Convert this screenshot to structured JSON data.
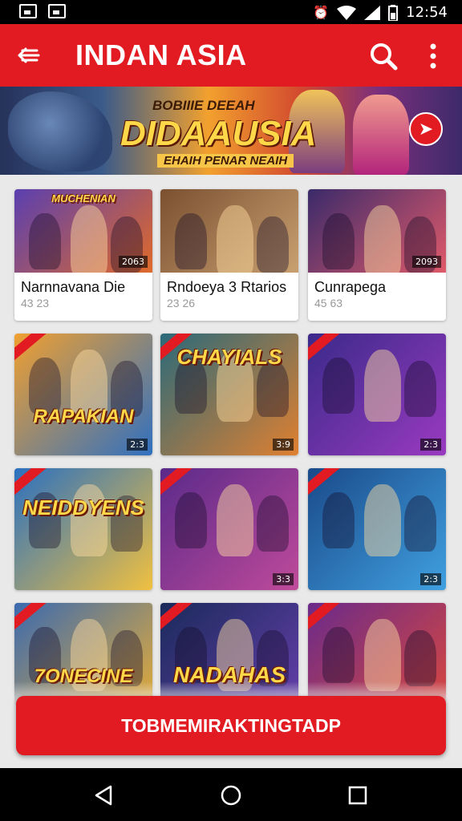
{
  "status_bar": {
    "time": "12:54"
  },
  "app_bar": {
    "title": "INDAN ASIA"
  },
  "banner": {
    "top_text": "BOBIIIE DEEAH",
    "title": "DIDAAUSIA",
    "subtitle": "EHAIH PENAR NEAIH"
  },
  "cards": [
    {
      "title": "Narnnavana Die",
      "meta": "43 23",
      "art_text": "MUCHENIAN",
      "badge": "2063",
      "colors": [
        "#5a3fb0",
        "#e06a2a"
      ],
      "style": "labeled"
    },
    {
      "title": "Rndoeya 3 Rtarios",
      "meta": "23 26",
      "art_text": "",
      "badge": "",
      "colors": [
        "#7a5030",
        "#c8a070"
      ],
      "style": "labeled"
    },
    {
      "title": "Cunrapega",
      "meta": "45 63",
      "art_text": "",
      "badge": "2093",
      "colors": [
        "#3a2a6a",
        "#e05a6a"
      ],
      "style": "labeled"
    },
    {
      "title": "",
      "meta": "",
      "art_text": "RAPAKIAN",
      "badge": "2:3",
      "colors": [
        "#f0a030",
        "#3070c0"
      ],
      "style": "art"
    },
    {
      "title": "",
      "meta": "",
      "art_text": "CHAYIALS",
      "badge": "3:9",
      "colors": [
        "#2a6a7a",
        "#e08030"
      ],
      "style": "art"
    },
    {
      "title": "",
      "meta": "",
      "art_text": "",
      "badge": "2:3",
      "colors": [
        "#3a2a8a",
        "#9a3ac0"
      ],
      "style": "art"
    },
    {
      "title": "",
      "meta": "",
      "art_text": "NEIDDYENS",
      "badge": "",
      "colors": [
        "#2a70c0",
        "#f0c040"
      ],
      "style": "art"
    },
    {
      "title": "",
      "meta": "",
      "art_text": "",
      "badge": "3:3",
      "colors": [
        "#5a2a8a",
        "#c04a9a"
      ],
      "style": "art"
    },
    {
      "title": "",
      "meta": "",
      "art_text": "",
      "badge": "2:3",
      "colors": [
        "#1a4a8a",
        "#40a0e0"
      ],
      "style": "art"
    },
    {
      "title": "",
      "meta": "",
      "art_text": "7ONECINE",
      "badge": "",
      "colors": [
        "#3a6ab0",
        "#f0b030"
      ],
      "style": "art"
    },
    {
      "title": "",
      "meta": "",
      "art_text": "NADAHAS",
      "badge": "",
      "colors": [
        "#1a2a5a",
        "#6a40b0"
      ],
      "style": "art"
    },
    {
      "title": "",
      "meta": "",
      "art_text": "",
      "badge": "",
      "colors": [
        "#6a2a8a",
        "#e04a3a"
      ],
      "style": "art"
    }
  ],
  "cta": {
    "label": "TOBMEMIRAKTINGTADP"
  }
}
